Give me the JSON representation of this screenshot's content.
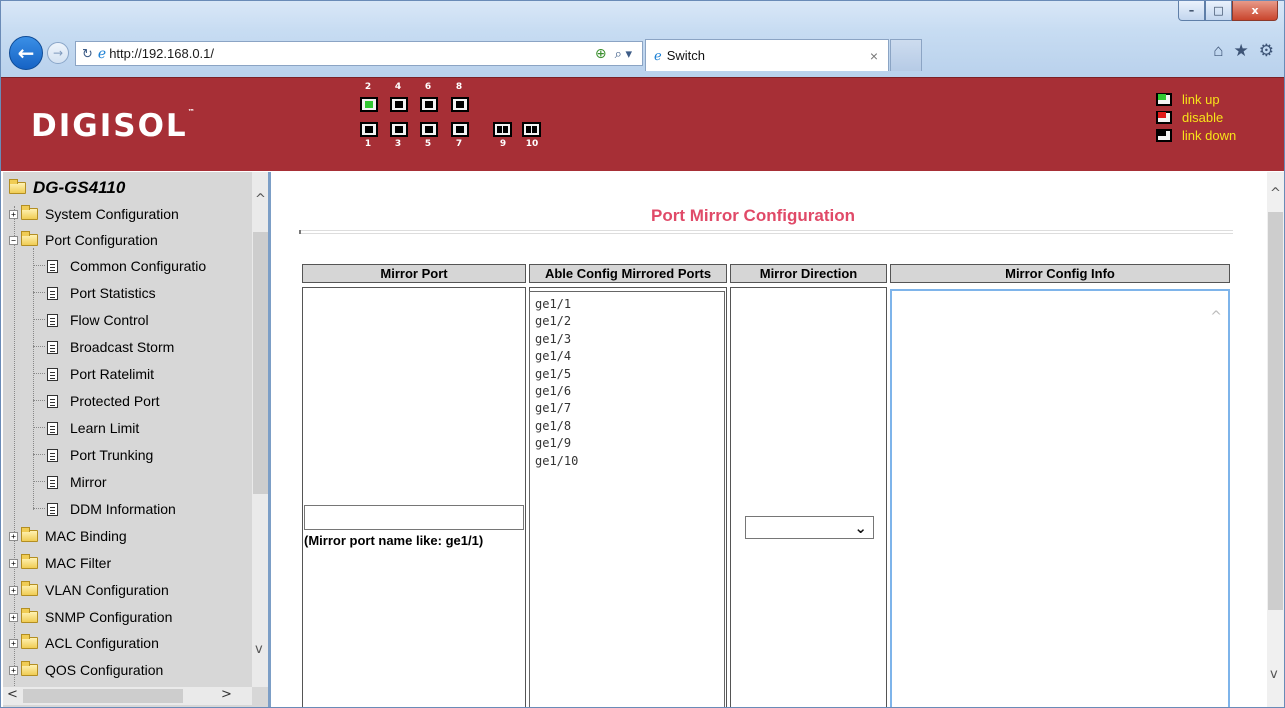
{
  "browser": {
    "url": "http://192.168.0.1/",
    "tab_title": "Switch",
    "window_buttons": {
      "minimize": "–",
      "maximize": "□",
      "close": "x"
    }
  },
  "banner": {
    "logo_text": "DIGISOL",
    "logo_tm": "™",
    "ports_top_labels": [
      "2",
      "4",
      "6",
      "8"
    ],
    "ports_bottom_labels": [
      "1",
      "3",
      "5",
      "7",
      "9",
      "10"
    ],
    "port_states": {
      "1": "link down",
      "2": "link up",
      "3": "link down",
      "4": "link down",
      "5": "link down",
      "6": "link down",
      "7": "link down",
      "8": "link down",
      "9": "link down",
      "10": "link down"
    },
    "legend": [
      {
        "label": "link up",
        "color": "#32c832"
      },
      {
        "label": "disable",
        "color": "#e21a1a"
      },
      {
        "label": "link down",
        "color": "#000000"
      }
    ]
  },
  "tree": {
    "root": "DG-GS4110",
    "items": [
      {
        "label": "System Configuration",
        "type": "folder",
        "expanded": false
      },
      {
        "label": "Port Configuration",
        "type": "folder",
        "expanded": true
      },
      {
        "label": "Common Configuratio",
        "type": "page"
      },
      {
        "label": "Port Statistics",
        "type": "page"
      },
      {
        "label": "Flow Control",
        "type": "page"
      },
      {
        "label": "Broadcast Storm",
        "type": "page"
      },
      {
        "label": "Port Ratelimit",
        "type": "page"
      },
      {
        "label": "Protected Port",
        "type": "page"
      },
      {
        "label": "Learn Limit",
        "type": "page"
      },
      {
        "label": "Port Trunking",
        "type": "page"
      },
      {
        "label": "Mirror",
        "type": "page"
      },
      {
        "label": "DDM Information",
        "type": "page"
      },
      {
        "label": "MAC Binding",
        "type": "folder",
        "expanded": false
      },
      {
        "label": "MAC Filter",
        "type": "folder",
        "expanded": false
      },
      {
        "label": "VLAN Configuration",
        "type": "folder",
        "expanded": false
      },
      {
        "label": "SNMP Configuration",
        "type": "folder",
        "expanded": false
      },
      {
        "label": "ACL Configuration",
        "type": "folder",
        "expanded": false
      },
      {
        "label": "QOS Configuration",
        "type": "folder",
        "expanded": false
      }
    ]
  },
  "main": {
    "title": "Port Mirror Configuration",
    "columns": [
      "Mirror Port",
      "Able Config Mirrored Ports",
      "Mirror Direction",
      "Mirror Config Info"
    ],
    "mirror_port_value": "",
    "mirror_port_hint": "(Mirror port name like: ge1/1)",
    "mirrored_ports": [
      "ge1/1",
      "ge1/2",
      "ge1/3",
      "ge1/4",
      "ge1/5",
      "ge1/6",
      "ge1/7",
      "ge1/8",
      "ge1/9",
      "ge1/10"
    ],
    "mirror_direction_selected": "",
    "mirror_config_info": ""
  }
}
